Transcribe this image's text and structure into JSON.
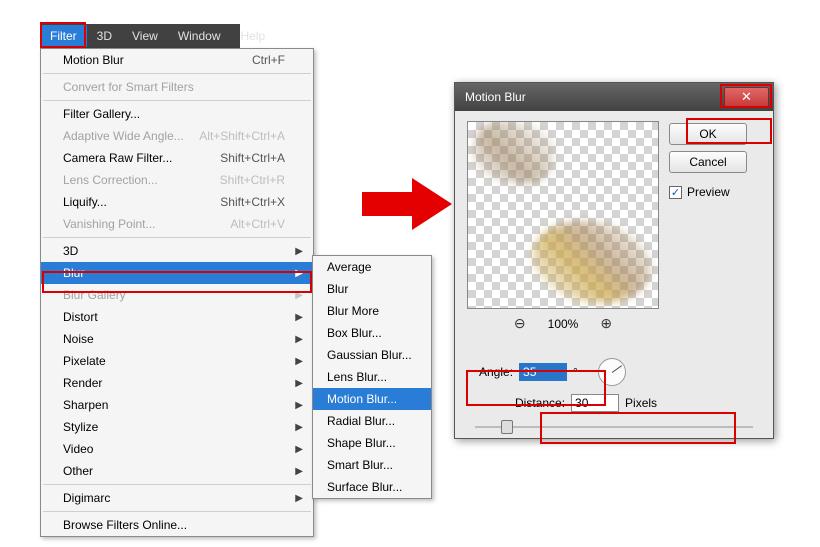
{
  "menubar": {
    "items": [
      "Filter",
      "3D",
      "View",
      "Window",
      "Help"
    ]
  },
  "filter_menu": {
    "last_filter": {
      "label": "Motion Blur",
      "shortcut": "Ctrl+F"
    },
    "convert_smart": "Convert for Smart Filters",
    "gallery": "Filter Gallery...",
    "awa": {
      "label": "Adaptive Wide Angle...",
      "shortcut": "Alt+Shift+Ctrl+A"
    },
    "crf": {
      "label": "Camera Raw Filter...",
      "shortcut": "Shift+Ctrl+A"
    },
    "lens": {
      "label": "Lens Correction...",
      "shortcut": "Shift+Ctrl+R"
    },
    "liquify": {
      "label": "Liquify...",
      "shortcut": "Shift+Ctrl+X"
    },
    "vanish": {
      "label": "Vanishing Point...",
      "shortcut": "Alt+Ctrl+V"
    },
    "groups": {
      "g3d": "3D",
      "blur": "Blur",
      "blur_gallery": "Blur Gallery",
      "distort": "Distort",
      "noise": "Noise",
      "pixelate": "Pixelate",
      "render": "Render",
      "sharpen": "Sharpen",
      "stylize": "Stylize",
      "video": "Video",
      "other": "Other",
      "digimarc": "Digimarc",
      "browse": "Browse Filters Online..."
    }
  },
  "blur_submenu": {
    "average": "Average",
    "blur": "Blur",
    "blur_more": "Blur More",
    "box": "Box Blur...",
    "gaussian": "Gaussian Blur...",
    "lens": "Lens Blur...",
    "motion": "Motion Blur...",
    "radial": "Radial Blur...",
    "shape": "Shape Blur...",
    "smart": "Smart Blur...",
    "surface": "Surface Blur..."
  },
  "dialog": {
    "title": "Motion Blur",
    "ok": "OK",
    "cancel": "Cancel",
    "preview": "Preview",
    "zoom": "100%",
    "angle_label": "Angle:",
    "angle_value": "35",
    "angle_deg": "°",
    "distance_label": "Distance:",
    "distance_value": "30",
    "distance_unit": "Pixels"
  }
}
